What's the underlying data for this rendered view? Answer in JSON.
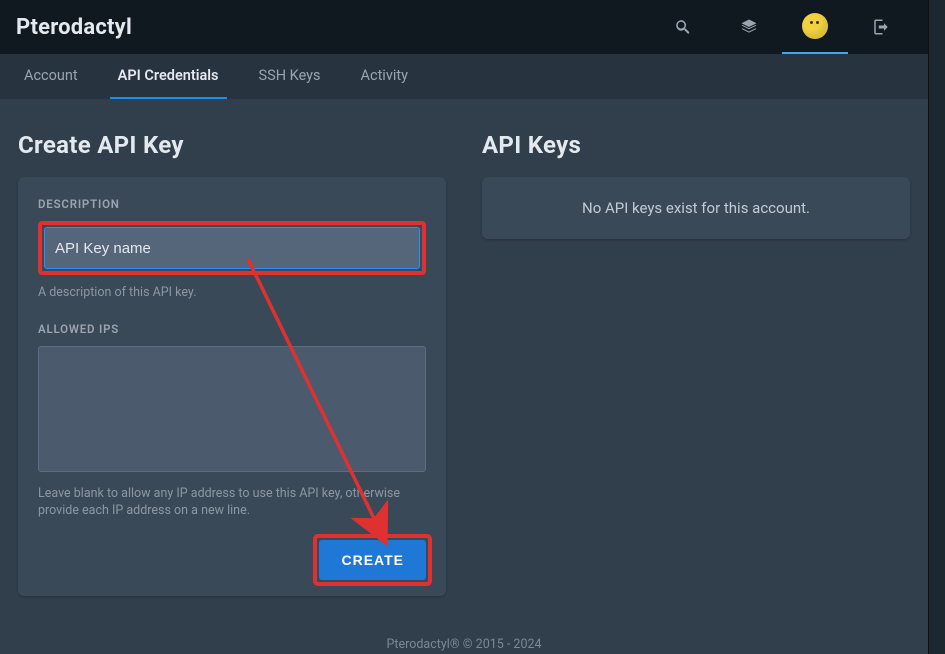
{
  "header": {
    "brand": "Pterodactyl",
    "actions": {
      "search_icon": "search",
      "servers_icon": "layers",
      "avatar": "avatar",
      "logout_icon": "logout"
    }
  },
  "tabs": [
    {
      "label": "Account",
      "active": false
    },
    {
      "label": "API Credentials",
      "active": true
    },
    {
      "label": "SSH Keys",
      "active": false
    },
    {
      "label": "Activity",
      "active": false
    }
  ],
  "create": {
    "title": "Create API Key",
    "description_label": "DESCRIPTION",
    "description_value": "API Key name",
    "description_help": "A description of this API key.",
    "allowed_label": "ALLOWED IPS",
    "allowed_value": "",
    "allowed_help": "Leave blank to allow any IP address to use this API key, otherwise provide each IP address on a new line.",
    "button_label": "CREATE"
  },
  "list": {
    "title": "API Keys",
    "empty_text": "No API keys exist for this account."
  },
  "footer": {
    "text": "Pterodactyl® © 2015 - 2024"
  }
}
